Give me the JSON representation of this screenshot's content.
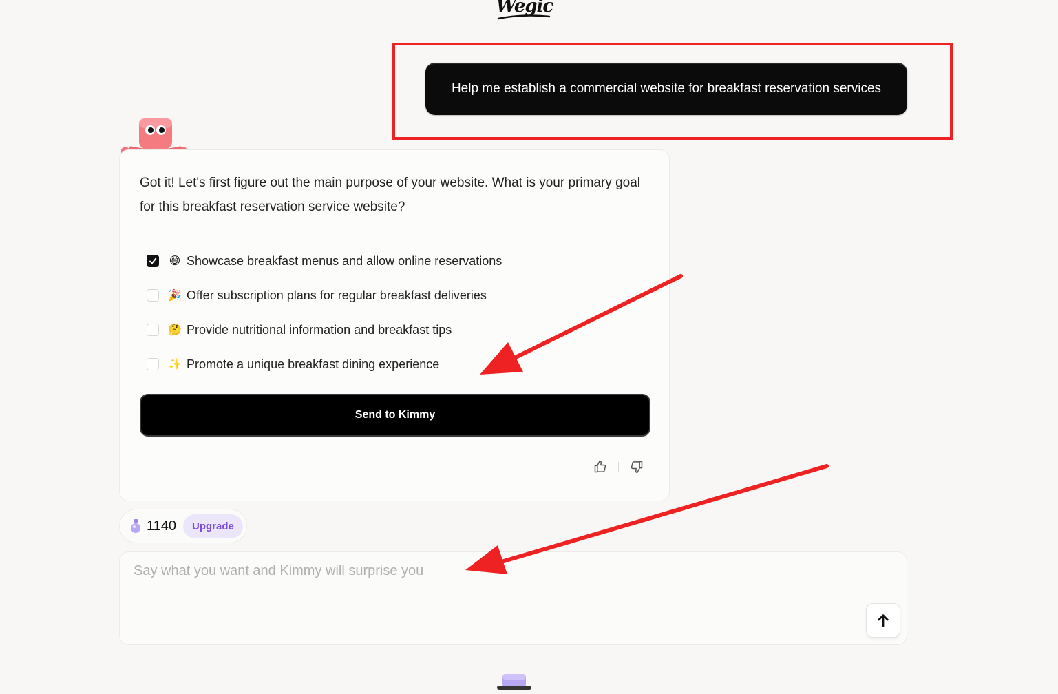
{
  "header": {
    "logo_text": "Wegic",
    "logo_icon": "wegic-logo"
  },
  "user_message": {
    "text": "Help me establish a commercial website for breakfast reservation services"
  },
  "assistant": {
    "avatar": "kimmy-mascot-icon",
    "question": "Got it! Let's first figure out the main purpose of your website. What is your primary goal for this breakfast reservation service website?",
    "options": [
      {
        "emoji": "😄",
        "label": "Showcase breakfast menus and allow online reservations",
        "checked": true
      },
      {
        "emoji": "🎉",
        "label": "Offer subscription plans for regular breakfast deliveries",
        "checked": false
      },
      {
        "emoji": "🤔",
        "label": "Provide nutritional information and breakfast tips",
        "checked": false
      },
      {
        "emoji": "✨",
        "label": "Promote a unique breakfast dining experience",
        "checked": false
      }
    ],
    "send_label": "Send to Kimmy",
    "feedback": [
      "thumbs-up-icon",
      "thumbs-down-icon"
    ]
  },
  "credits": {
    "icon": "potion-icon",
    "count": "1140",
    "upgrade_label": "Upgrade"
  },
  "composer": {
    "placeholder": "Say what you want and Kimmy will surprise you",
    "value": "",
    "submit_icon": "arrow-up-icon"
  },
  "annotations": {
    "highlight_color": "#ee2222",
    "arrow_color": "#ee2222"
  }
}
